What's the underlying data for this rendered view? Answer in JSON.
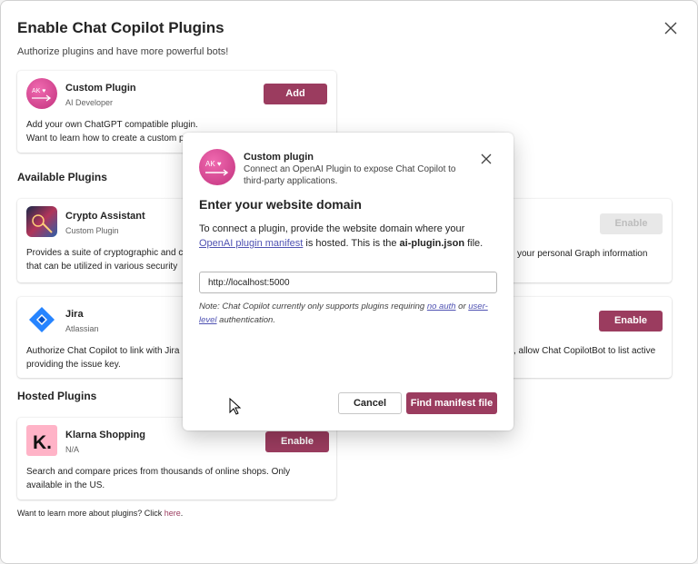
{
  "dialog": {
    "title": "Enable Chat Copilot Plugins",
    "subtitle": "Authorize plugins and have more powerful bots!"
  },
  "custom_card": {
    "name": "Custom Plugin",
    "publisher": "AI Developer",
    "add_label": "Add",
    "desc_line1": "Add your own ChatGPT compatible plugin.",
    "desc_line2": "Want to learn how to create a custom p",
    "logo_text": "AK ♥"
  },
  "sections": {
    "available": "Available Plugins",
    "hosted": "Hosted Plugins"
  },
  "crypto_card": {
    "name": "Crypto Assistant",
    "publisher": "Custom Plugin",
    "desc_line1": "Provides a suite of cryptographic and c",
    "desc_line2": "that can be utilized in various security"
  },
  "graph_card": {
    "enable_label": "Enable",
    "desc_line1": "your personal Graph information"
  },
  "jira_card": {
    "name": "Jira",
    "publisher": "Atlassian",
    "desc_line1": "Authorize Chat Copilot to link with Jira",
    "desc_line2": "providing the issue key."
  },
  "right_jira_card": {
    "enable_label": "Enable",
    "desc_line1": ", allow Chat CopilotBot to list active"
  },
  "klarna_card": {
    "name": "Klarna Shopping",
    "publisher": "N/A",
    "enable_label": "Enable",
    "desc_line1": "Search and compare prices from thousands of online shops. Only",
    "desc_line2": "available in the US.",
    "logo_text": "K."
  },
  "footer": {
    "text": "Want to learn more about plugins? Click ",
    "link": "here",
    "end": "."
  },
  "modal": {
    "name": "Custom plugin",
    "sub": "Connect an OpenAI Plugin to expose Chat Copilot to third-party applications.",
    "heading": "Enter your website domain",
    "body_1": "To connect a plugin, provide the website domain where your ",
    "body_link": "OpenAI plugin manifest",
    "body_2": " is hosted. This is the ",
    "body_bold": "ai-plugin.json",
    "body_3": " file.",
    "input_value": "http://localhost:5000",
    "note_1": "Note: Chat Copilot currently only supports plugins requiring ",
    "note_link1": "no auth",
    "note_2": " or ",
    "note_link2": "user-level",
    "note_3": " authentication.",
    "cancel_label": "Cancel",
    "find_label": "Find manifest file",
    "logo_text": "AK ♥"
  },
  "colors": {
    "accent": "#9b3c5f",
    "link": "#4f52b2",
    "jira_blue": "#2684ff",
    "klarna_pink": "#ffb3c7"
  }
}
